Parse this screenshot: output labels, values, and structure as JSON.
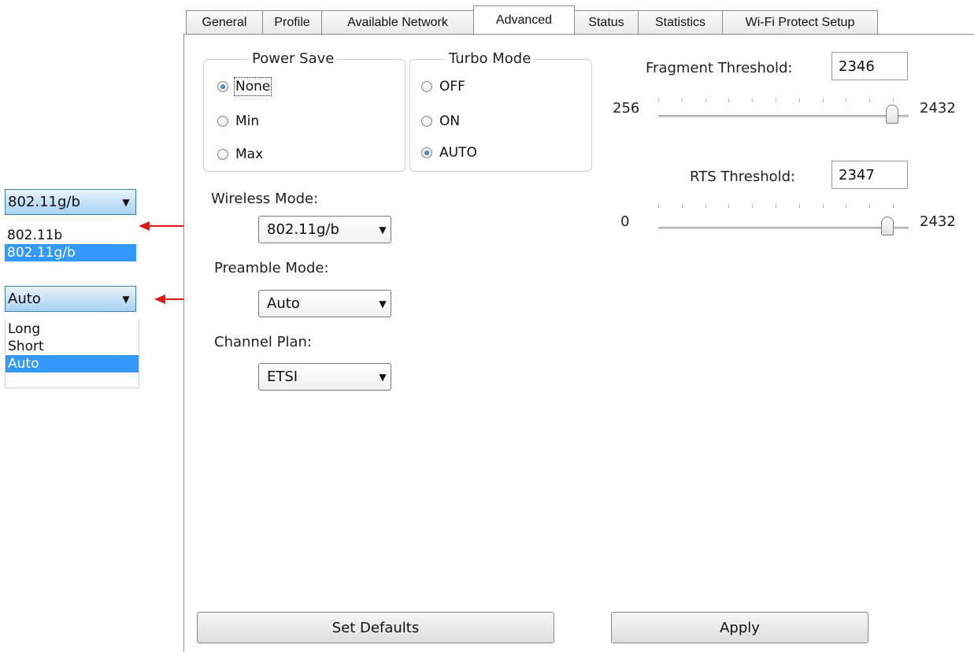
{
  "tabs": [
    {
      "label": "General",
      "active": false
    },
    {
      "label": "Profile",
      "active": false
    },
    {
      "label": "Available Network",
      "active": false
    },
    {
      "label": "Advanced",
      "active": true
    },
    {
      "label": "Status",
      "active": false
    },
    {
      "label": "Statistics",
      "active": false
    },
    {
      "label": "Wi-Fi Protect Setup",
      "active": false
    }
  ],
  "power_save": {
    "title": "Power Save",
    "options": [
      "None",
      "Min",
      "Max"
    ],
    "selected": "None"
  },
  "turbo_mode": {
    "title": "Turbo Mode",
    "options": [
      "OFF",
      "ON",
      "AUTO"
    ],
    "selected": "AUTO"
  },
  "wireless_mode": {
    "label": "Wireless Mode:",
    "value": "802.11g/b"
  },
  "preamble_mode": {
    "label": "Preamble Mode:",
    "value": "Auto"
  },
  "channel_plan": {
    "label": "Channel Plan:",
    "value": "ETSI"
  },
  "fragment_threshold": {
    "label": "Fragment Threshold:",
    "value": "2346",
    "min": "256",
    "max": "2432",
    "level_fraction": 0.99
  },
  "rts_threshold": {
    "label": "RTS Threshold:",
    "value": "2347",
    "min": "0",
    "max": "2432",
    "level_fraction": 0.97
  },
  "buttons": {
    "set_defaults": "Set Defaults",
    "apply": "Apply"
  },
  "callouts": {
    "wireless_dropdown": {
      "value": "802.11g/b",
      "options": [
        "802.11b",
        "802.11g/b"
      ],
      "selected": "802.11g/b"
    },
    "preamble_dropdown": {
      "value": "Auto",
      "options": [
        "Long",
        "Short",
        "Auto"
      ],
      "selected": "Auto"
    }
  },
  "colors": {
    "selection": "#3399ff",
    "callout_arrow": "#e01818",
    "radio_dot": "#1f4f8c"
  }
}
